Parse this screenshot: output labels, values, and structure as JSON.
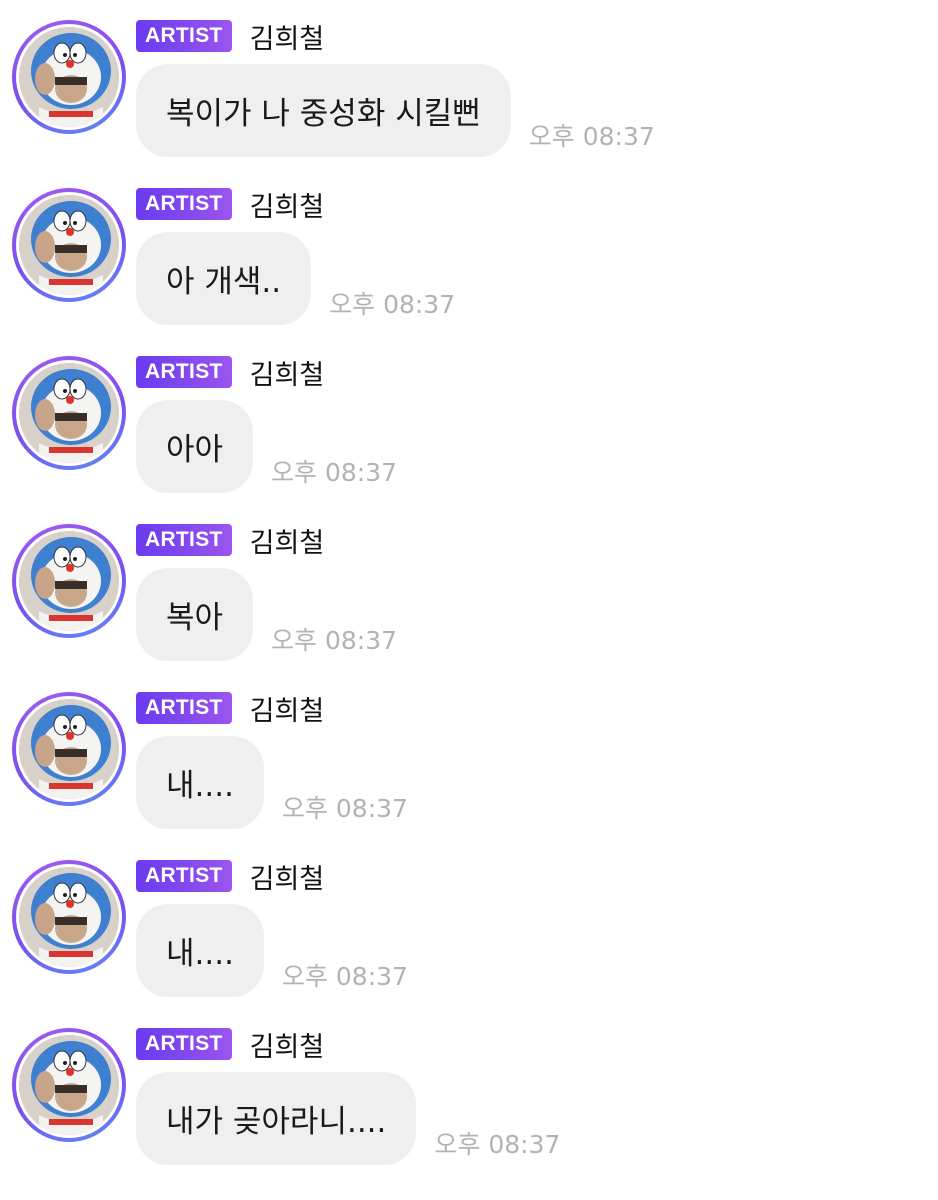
{
  "messages": [
    {
      "badge": "ARTIST",
      "sender": "김희철",
      "text": "복이가 나 중성화 시킬뻔",
      "time": "오후 08:37"
    },
    {
      "badge": "ARTIST",
      "sender": "김희철",
      "text": "아 개색..",
      "time": "오후 08:37"
    },
    {
      "badge": "ARTIST",
      "sender": "김희철",
      "text": "아아",
      "time": "오후 08:37"
    },
    {
      "badge": "ARTIST",
      "sender": "김희철",
      "text": "복아",
      "time": "오후 08:37"
    },
    {
      "badge": "ARTIST",
      "sender": "김희철",
      "text": "내....",
      "time": "오후 08:37"
    },
    {
      "badge": "ARTIST",
      "sender": "김희철",
      "text": "내....",
      "time": "오후 08:37"
    },
    {
      "badge": "ARTIST",
      "sender": "김희철",
      "text": "내가 곶아라니....",
      "time": "오후 08:37"
    }
  ],
  "avatar_icon": "doraemon-hood-profile-photo",
  "colors": {
    "badge_start": "#6a3bf0",
    "badge_end": "#9a55ee",
    "bubble": "#efefef",
    "time": "#b3b3b3",
    "avatar_ring": "#8a55f0"
  }
}
